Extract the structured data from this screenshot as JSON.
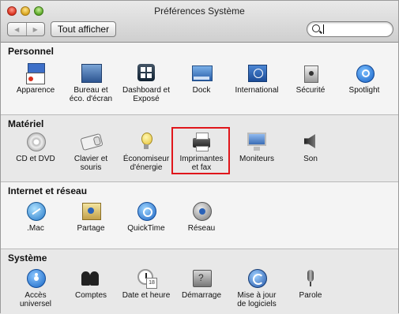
{
  "window": {
    "title": "Préférences Système"
  },
  "toolbar": {
    "back": "◀",
    "forward": "▶",
    "show_all": "Tout afficher",
    "search_value": ""
  },
  "sections": [
    {
      "title": "Personnel",
      "items": [
        {
          "label": "Apparence",
          "icon": "appearance-icon"
        },
        {
          "label": "Bureau et\néco. d'écran",
          "icon": "desktop-screensaver-icon"
        },
        {
          "label": "Dashboard et\nExposé",
          "icon": "dashboard-expose-icon"
        },
        {
          "label": "Dock",
          "icon": "dock-icon"
        },
        {
          "label": "International",
          "icon": "international-icon"
        },
        {
          "label": "Sécurité",
          "icon": "security-icon"
        },
        {
          "label": "Spotlight",
          "icon": "spotlight-icon"
        }
      ]
    },
    {
      "title": "Matériel",
      "items": [
        {
          "label": "CD et DVD",
          "icon": "cd-dvd-icon"
        },
        {
          "label": "Clavier et\nsouris",
          "icon": "keyboard-mouse-icon"
        },
        {
          "label": "Économiseur\nd'énergie",
          "icon": "energy-saver-icon"
        },
        {
          "label": "Imprimantes\net fax",
          "icon": "printer-fax-icon",
          "highlighted": true
        },
        {
          "label": "Moniteurs",
          "icon": "displays-icon"
        },
        {
          "label": "Son",
          "icon": "sound-icon"
        }
      ]
    },
    {
      "title": "Internet et réseau",
      "items": [
        {
          "label": ".Mac",
          "icon": "dotmac-icon"
        },
        {
          "label": "Partage",
          "icon": "sharing-icon"
        },
        {
          "label": "QuickTime",
          "icon": "quicktime-icon"
        },
        {
          "label": "Réseau",
          "icon": "network-icon"
        }
      ]
    },
    {
      "title": "Système",
      "items": [
        {
          "label": "Accès\nuniversel",
          "icon": "universal-access-icon"
        },
        {
          "label": "Comptes",
          "icon": "accounts-icon"
        },
        {
          "label": "Date et heure",
          "icon": "date-time-icon"
        },
        {
          "label": "Démarrage",
          "icon": "startup-disk-icon"
        },
        {
          "label": "Mise à jour\nde logiciels",
          "icon": "software-update-icon"
        },
        {
          "label": "Parole",
          "icon": "speech-icon"
        }
      ]
    }
  ],
  "colors": {
    "highlight": "#e0161b"
  }
}
